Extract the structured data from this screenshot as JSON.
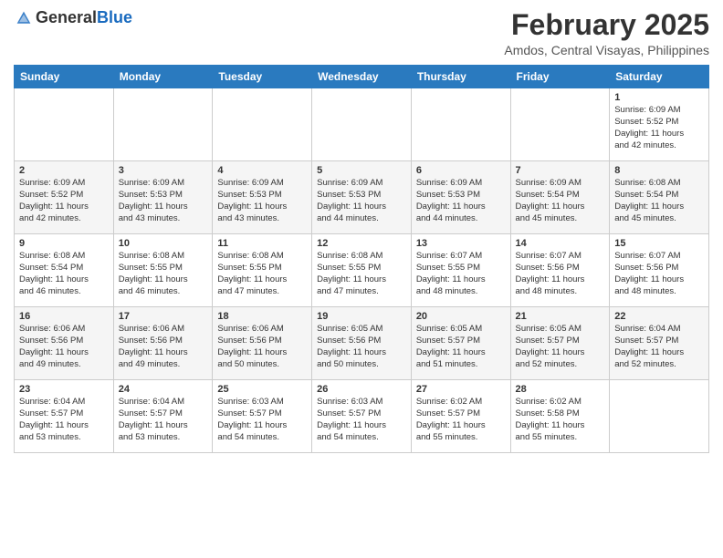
{
  "header": {
    "logo_general": "General",
    "logo_blue": "Blue",
    "month": "February 2025",
    "location": "Amdos, Central Visayas, Philippines"
  },
  "weekdays": [
    "Sunday",
    "Monday",
    "Tuesday",
    "Wednesday",
    "Thursday",
    "Friday",
    "Saturday"
  ],
  "weeks": [
    [
      {
        "day": null,
        "info": null
      },
      {
        "day": null,
        "info": null
      },
      {
        "day": null,
        "info": null
      },
      {
        "day": null,
        "info": null
      },
      {
        "day": null,
        "info": null
      },
      {
        "day": null,
        "info": null
      },
      {
        "day": "1",
        "info": "Sunrise: 6:09 AM\nSunset: 5:52 PM\nDaylight: 11 hours\nand 42 minutes."
      }
    ],
    [
      {
        "day": "2",
        "info": "Sunrise: 6:09 AM\nSunset: 5:52 PM\nDaylight: 11 hours\nand 42 minutes."
      },
      {
        "day": "3",
        "info": "Sunrise: 6:09 AM\nSunset: 5:53 PM\nDaylight: 11 hours\nand 43 minutes."
      },
      {
        "day": "4",
        "info": "Sunrise: 6:09 AM\nSunset: 5:53 PM\nDaylight: 11 hours\nand 43 minutes."
      },
      {
        "day": "5",
        "info": "Sunrise: 6:09 AM\nSunset: 5:53 PM\nDaylight: 11 hours\nand 44 minutes."
      },
      {
        "day": "6",
        "info": "Sunrise: 6:09 AM\nSunset: 5:53 PM\nDaylight: 11 hours\nand 44 minutes."
      },
      {
        "day": "7",
        "info": "Sunrise: 6:09 AM\nSunset: 5:54 PM\nDaylight: 11 hours\nand 45 minutes."
      },
      {
        "day": "8",
        "info": "Sunrise: 6:08 AM\nSunset: 5:54 PM\nDaylight: 11 hours\nand 45 minutes."
      }
    ],
    [
      {
        "day": "9",
        "info": "Sunrise: 6:08 AM\nSunset: 5:54 PM\nDaylight: 11 hours\nand 46 minutes."
      },
      {
        "day": "10",
        "info": "Sunrise: 6:08 AM\nSunset: 5:55 PM\nDaylight: 11 hours\nand 46 minutes."
      },
      {
        "day": "11",
        "info": "Sunrise: 6:08 AM\nSunset: 5:55 PM\nDaylight: 11 hours\nand 47 minutes."
      },
      {
        "day": "12",
        "info": "Sunrise: 6:08 AM\nSunset: 5:55 PM\nDaylight: 11 hours\nand 47 minutes."
      },
      {
        "day": "13",
        "info": "Sunrise: 6:07 AM\nSunset: 5:55 PM\nDaylight: 11 hours\nand 48 minutes."
      },
      {
        "day": "14",
        "info": "Sunrise: 6:07 AM\nSunset: 5:56 PM\nDaylight: 11 hours\nand 48 minutes."
      },
      {
        "day": "15",
        "info": "Sunrise: 6:07 AM\nSunset: 5:56 PM\nDaylight: 11 hours\nand 48 minutes."
      }
    ],
    [
      {
        "day": "16",
        "info": "Sunrise: 6:06 AM\nSunset: 5:56 PM\nDaylight: 11 hours\nand 49 minutes."
      },
      {
        "day": "17",
        "info": "Sunrise: 6:06 AM\nSunset: 5:56 PM\nDaylight: 11 hours\nand 49 minutes."
      },
      {
        "day": "18",
        "info": "Sunrise: 6:06 AM\nSunset: 5:56 PM\nDaylight: 11 hours\nand 50 minutes."
      },
      {
        "day": "19",
        "info": "Sunrise: 6:05 AM\nSunset: 5:56 PM\nDaylight: 11 hours\nand 50 minutes."
      },
      {
        "day": "20",
        "info": "Sunrise: 6:05 AM\nSunset: 5:57 PM\nDaylight: 11 hours\nand 51 minutes."
      },
      {
        "day": "21",
        "info": "Sunrise: 6:05 AM\nSunset: 5:57 PM\nDaylight: 11 hours\nand 52 minutes."
      },
      {
        "day": "22",
        "info": "Sunrise: 6:04 AM\nSunset: 5:57 PM\nDaylight: 11 hours\nand 52 minutes."
      }
    ],
    [
      {
        "day": "23",
        "info": "Sunrise: 6:04 AM\nSunset: 5:57 PM\nDaylight: 11 hours\nand 53 minutes."
      },
      {
        "day": "24",
        "info": "Sunrise: 6:04 AM\nSunset: 5:57 PM\nDaylight: 11 hours\nand 53 minutes."
      },
      {
        "day": "25",
        "info": "Sunrise: 6:03 AM\nSunset: 5:57 PM\nDaylight: 11 hours\nand 54 minutes."
      },
      {
        "day": "26",
        "info": "Sunrise: 6:03 AM\nSunset: 5:57 PM\nDaylight: 11 hours\nand 54 minutes."
      },
      {
        "day": "27",
        "info": "Sunrise: 6:02 AM\nSunset: 5:57 PM\nDaylight: 11 hours\nand 55 minutes."
      },
      {
        "day": "28",
        "info": "Sunrise: 6:02 AM\nSunset: 5:58 PM\nDaylight: 11 hours\nand 55 minutes."
      },
      {
        "day": null,
        "info": null
      }
    ]
  ]
}
